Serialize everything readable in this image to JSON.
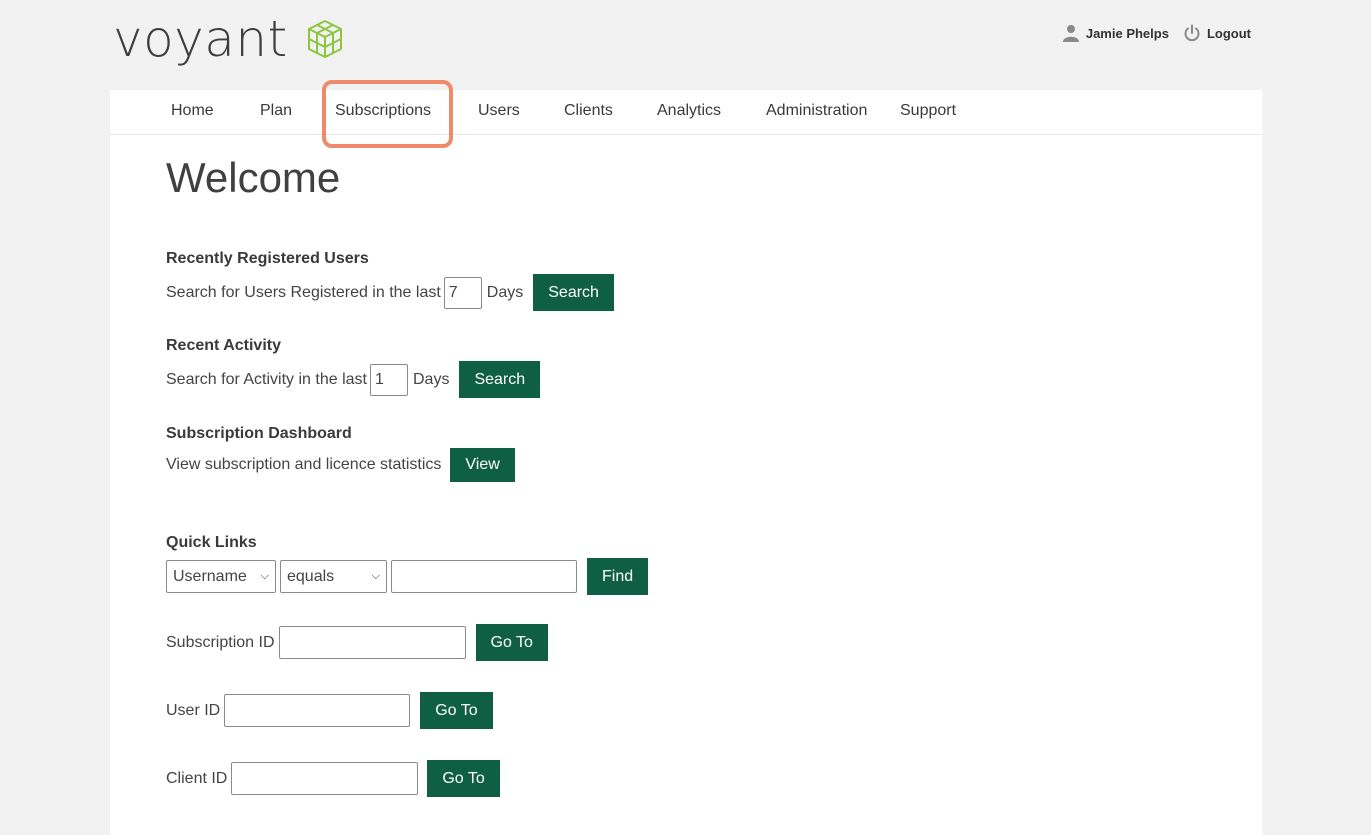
{
  "header": {
    "logo_text": "voyant",
    "user_name": "Jamie Phelps",
    "logout_label": "Logout"
  },
  "nav": {
    "items": [
      {
        "label": "Home"
      },
      {
        "label": "Plan"
      },
      {
        "label": "Subscriptions"
      },
      {
        "label": "Users"
      },
      {
        "label": "Clients"
      },
      {
        "label": "Analytics"
      },
      {
        "label": "Administration"
      },
      {
        "label": "Support"
      }
    ],
    "highlighted": "Subscriptions"
  },
  "page": {
    "title": "Welcome"
  },
  "recent_users": {
    "title": "Recently Registered Users",
    "prefix": "Search for Users Registered in the last",
    "days_value": "7",
    "suffix": "Days",
    "button": "Search"
  },
  "recent_activity": {
    "title": "Recent Activity",
    "prefix": "Search for Activity in the last",
    "days_value": "1",
    "suffix": "Days",
    "button": "Search"
  },
  "subscription_dashboard": {
    "title": "Subscription Dashboard",
    "text": "View subscription and licence statistics",
    "button": "View"
  },
  "quick_links": {
    "title": "Quick Links",
    "field_select": "Username",
    "operator_select": "equals",
    "query_value": "",
    "find_button": "Find",
    "subscription_id_label": "Subscription ID",
    "subscription_id_value": "",
    "user_id_label": "User ID",
    "user_id_value": "",
    "client_id_label": "Client ID",
    "client_id_value": "",
    "goto_button": "Go To"
  },
  "colors": {
    "background": "#f2f2f2",
    "button_green": "#0e5f44",
    "highlight": "#ef8a6a",
    "logo_green": "#8cc63f"
  }
}
